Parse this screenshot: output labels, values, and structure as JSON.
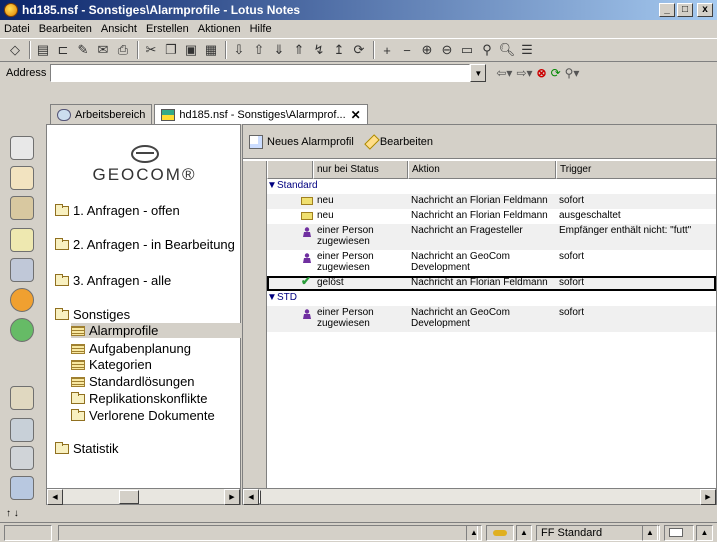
{
  "window": {
    "title": "hd185.nsf - Sonstiges\\Alarmprofile - Lotus Notes",
    "buttons": [
      "_",
      "□",
      "x"
    ]
  },
  "menu": [
    "Datei",
    "Bearbeiten",
    "Ansicht",
    "Erstellen",
    "Aktionen",
    "Hilfe"
  ],
  "address": {
    "label": "Address",
    "value": ""
  },
  "tabs": [
    {
      "label": "Arbeitsbereich"
    },
    {
      "label": "hd185.nsf - Sonstiges\\Alarmprof...",
      "close": "✕"
    }
  ],
  "navigator": {
    "logo": "GEOCOM®",
    "items": [
      {
        "label": "1. Anfragen - offen",
        "type": "folder"
      },
      {
        "label": "2. Anfragen - in Bearbeitung",
        "type": "folder"
      },
      {
        "label": "3. Anfragen - alle",
        "type": "folder"
      },
      {
        "label": "Sonstiges",
        "type": "folder-open"
      },
      {
        "label": "Alarmprofile",
        "type": "view",
        "selected": true
      },
      {
        "label": "Aufgabenplanung",
        "type": "view"
      },
      {
        "label": "Kategorien",
        "type": "view"
      },
      {
        "label": "Standardlösungen",
        "type": "view"
      },
      {
        "label": "Replikationskonflikte",
        "type": "folder"
      },
      {
        "label": "Verlorene Dokumente",
        "type": "folder"
      },
      {
        "label": "Statistik",
        "type": "folder"
      }
    ]
  },
  "actions": {
    "new_label": "Neues Alarmprofil",
    "edit_label": "Bearbeiten"
  },
  "columns": [
    "nur bei Status",
    "Aktion",
    "Trigger"
  ],
  "groups": [
    {
      "label": "Standard",
      "rows": [
        {
          "icon": "envelope-icon",
          "status": "neu",
          "action": "Nachricht an Florian Feldmann",
          "trigger": "sofort"
        },
        {
          "icon": "envelope-icon",
          "status": "neu",
          "action": "Nachricht an Florian Feldmann",
          "trigger": "ausgeschaltet"
        },
        {
          "icon": "person-icon",
          "status": "einer Person zugewiesen",
          "action": "Nachricht an Fragesteller",
          "trigger": "Empfänger enthält nicht: \"futt\""
        },
        {
          "icon": "person-icon",
          "status": "einer Person zugewiesen",
          "action": "Nachricht an GeoCom Development",
          "trigger": "sofort"
        },
        {
          "icon": "check-icon",
          "status": "gelöst",
          "action": "Nachricht an Florian Feldmann",
          "trigger": "sofort"
        }
      ]
    },
    {
      "label": "STD",
      "rows": [
        {
          "icon": "person-icon",
          "status": "einer Person zugewiesen",
          "action": "Nachricht an GeoCom Development",
          "trigger": "sofort"
        }
      ]
    }
  ],
  "statusbar": {
    "location": "FF Standard"
  }
}
